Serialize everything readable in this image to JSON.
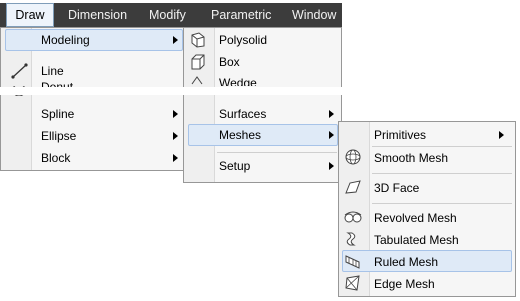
{
  "menubar": {
    "items": [
      {
        "label": "Draw"
      },
      {
        "label": "Dimension"
      },
      {
        "label": "Modify"
      },
      {
        "label": "Parametric"
      },
      {
        "label": "Window"
      }
    ]
  },
  "draw_menu": {
    "items": [
      {
        "label": "Modeling"
      },
      {
        "label": "Line"
      },
      {
        "label": "Donut"
      },
      {
        "label": "Spline"
      },
      {
        "label": "Ellipse"
      },
      {
        "label": "Block"
      }
    ]
  },
  "modeling_menu": {
    "items": [
      {
        "label": "Polysolid"
      },
      {
        "label": "Box"
      },
      {
        "label": "Wedge"
      },
      {
        "label": "Surfaces"
      },
      {
        "label": "Meshes"
      },
      {
        "label": "Setup"
      }
    ]
  },
  "meshes_menu": {
    "items": [
      {
        "label": "Primitives"
      },
      {
        "label": "Smooth Mesh"
      },
      {
        "label": "3D Face"
      },
      {
        "label": "Revolved Mesh"
      },
      {
        "label": "Tabulated Mesh"
      },
      {
        "label": "Ruled Mesh"
      },
      {
        "label": "Edge Mesh"
      }
    ]
  },
  "icons": [
    "line-icon",
    "donut-icon",
    "polysolid-icon",
    "box-icon",
    "wedge-icon",
    "smooth-mesh-icon",
    "3d-face-icon",
    "revolved-mesh-icon",
    "tabulated-mesh-icon",
    "ruled-mesh-icon",
    "edge-mesh-icon"
  ],
  "colors": {
    "menubar": "#3c3c3c",
    "highlight": "#dfeaf7",
    "highlight_border": "#a7c3e8",
    "panel": "#f6f6f6"
  }
}
